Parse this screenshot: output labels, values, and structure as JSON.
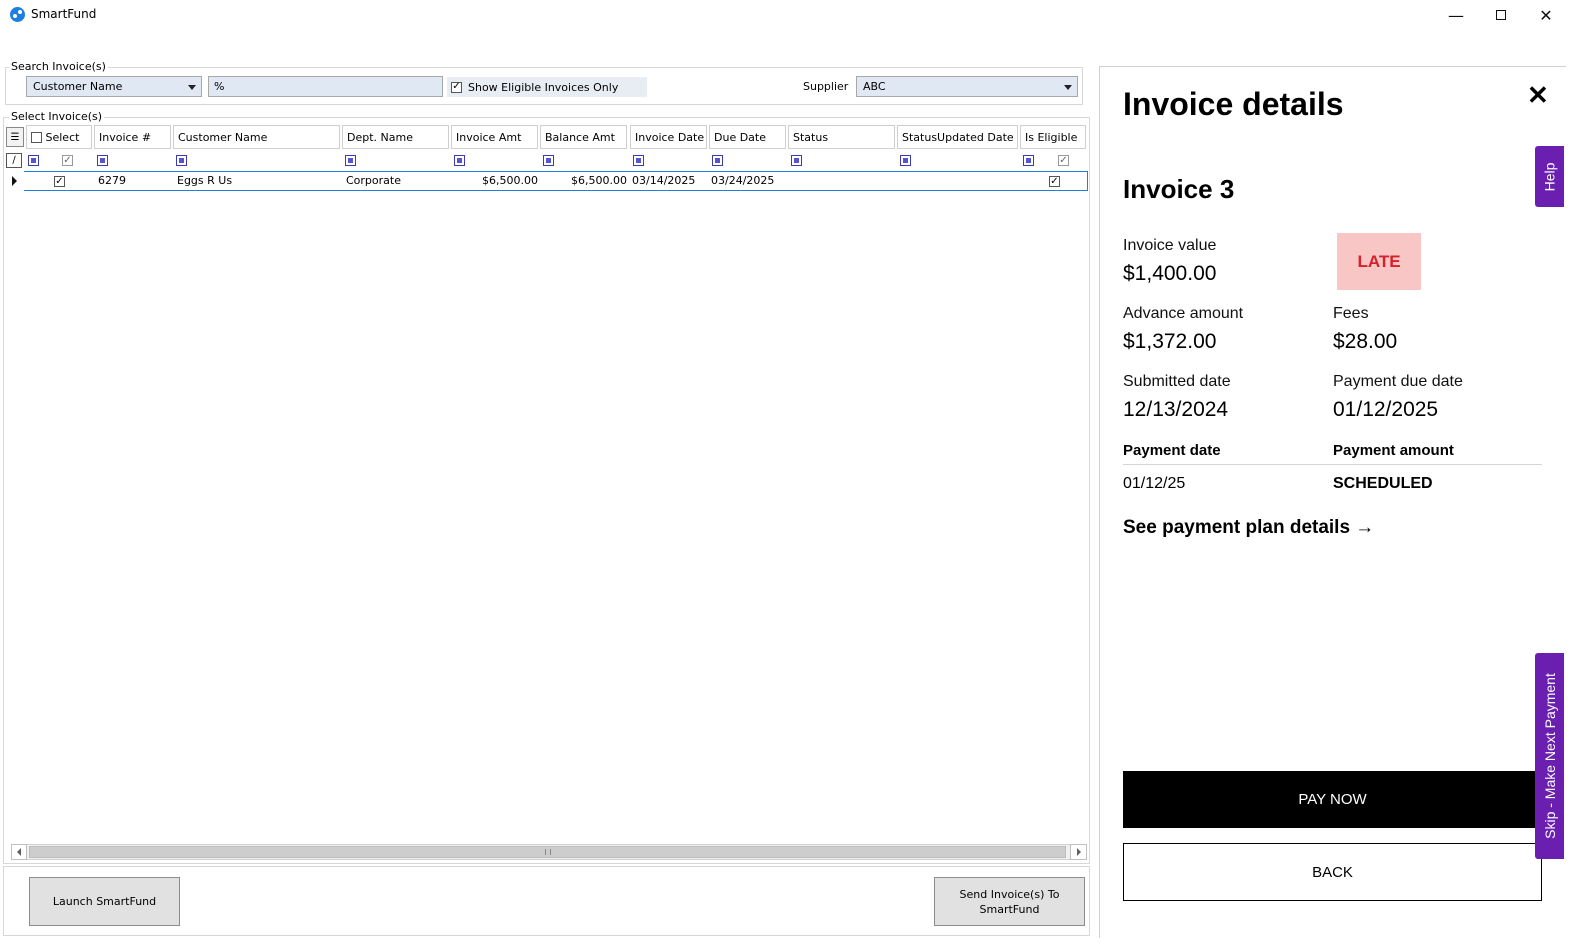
{
  "window": {
    "title": "SmartFund"
  },
  "search": {
    "group_label": "Search Invoice(s)",
    "field_selected": "Customer Name",
    "query_value": "%",
    "eligible_only_label": "Show Eligible Invoices Only",
    "eligible_only_checked": true,
    "supplier_label": "Supplier",
    "supplier_selected": "ABC"
  },
  "grid": {
    "group_label": "Select Invoice(s)",
    "columns": [
      "Select",
      "Invoice #",
      "Customer Name",
      "Dept. Name",
      "Invoice Amt",
      "Balance Amt",
      "Invoice Date",
      "Due Date",
      "Status",
      "StatusUpdated Date",
      "Is Eligible"
    ],
    "rows": [
      {
        "selected": true,
        "invoice_no": "6279",
        "customer": "Eggs R Us",
        "dept": "Corporate",
        "invoice_amt": "$6,500.00",
        "balance_amt": "$6,500.00",
        "invoice_date": "03/14/2025",
        "due_date": "03/24/2025",
        "status": "",
        "status_updated": "",
        "is_eligible": true
      }
    ]
  },
  "footer": {
    "launch_label": "Launch SmartFund",
    "send_label": "Send Invoice(s) To SmartFund"
  },
  "details": {
    "heading": "Invoice details",
    "invoice_name": "Invoice 3",
    "status_badge": "LATE",
    "invoice_value_label": "Invoice value",
    "invoice_value": "$1,400.00",
    "advance_label": "Advance amount",
    "advance_value": "$1,372.00",
    "fees_label": "Fees",
    "fees_value": "$28.00",
    "submitted_label": "Submitted date",
    "submitted_value": "12/13/2024",
    "due_label": "Payment due date",
    "due_value": "01/12/2025",
    "payments_headers": [
      "Payment date",
      "Payment amount"
    ],
    "payments": [
      {
        "date": "01/12/25",
        "amount": "SCHEDULED"
      }
    ],
    "plan_link": "See payment plan details →",
    "pay_now_label": "PAY NOW",
    "back_label": "BACK",
    "help_tab": "Help",
    "skip_tab": "Skip - Make Next Payment"
  },
  "colors": {
    "accent_purple": "#6a1fb0",
    "late_bg": "#f9c6c6",
    "late_text": "#d6202a",
    "selection_blue": "#1e7fe0"
  }
}
